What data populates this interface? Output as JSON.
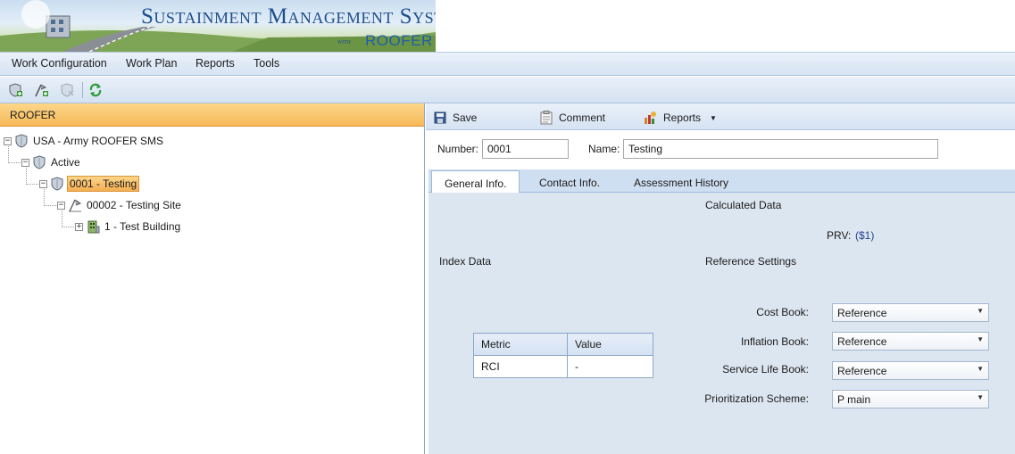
{
  "banner": {
    "title": "Sustainment Management Systems",
    "with": "with",
    "product": "ROOFER"
  },
  "menu": {
    "items": [
      {
        "label": "Work Configuration"
      },
      {
        "label": "Work Plan"
      },
      {
        "label": "Reports"
      },
      {
        "label": "Tools"
      }
    ]
  },
  "toolbar": {
    "icons": [
      "add-shield-icon",
      "add-site-icon",
      "delete-shield-icon",
      "refresh-icon"
    ]
  },
  "tree": {
    "header": "ROOFER",
    "nodes": [
      {
        "label": "USA - Army ROOFER SMS",
        "icon": "shield-icon",
        "expander": "−"
      },
      {
        "label": "Active",
        "icon": "shield-icon",
        "expander": "−"
      },
      {
        "label": "0001 - Testing",
        "icon": "shield-icon",
        "expander": "−",
        "selected": true
      },
      {
        "label": "00002 - Testing Site",
        "icon": "flag-icon",
        "expander": "−"
      },
      {
        "label": "1 - Test Building",
        "icon": "building-icon",
        "expander": "+"
      }
    ]
  },
  "detail": {
    "toolbar": {
      "save": "Save",
      "comment": "Comment",
      "reports": "Reports"
    },
    "number_label": "Number:",
    "number_value": "0001",
    "name_label": "Name:",
    "name_value": "Testing",
    "tabs": [
      "General Info.",
      "Contact Info.",
      "Assessment History"
    ],
    "active_tab": "General Info.",
    "calculated_data_title": "Calculated Data",
    "prv_label": "PRV:",
    "prv_value": "($1)",
    "index_data_title": "Index Data",
    "reference_settings_title": "Reference Settings",
    "metric_table": {
      "headers": [
        "Metric",
        "Value"
      ],
      "rows": [
        [
          "RCI",
          "-"
        ]
      ]
    },
    "settings": [
      {
        "label": "Cost Book:",
        "value": "Reference"
      },
      {
        "label": "Inflation Book:",
        "value": "Reference"
      },
      {
        "label": "Service Life Book:",
        "value": "Reference"
      },
      {
        "label": "Prioritization Scheme:",
        "value": "P main"
      }
    ]
  },
  "colors": {
    "accent_orange": "#f7b95a",
    "brand_blue": "#1f4f8c",
    "panel_blue": "#dce6f1"
  }
}
